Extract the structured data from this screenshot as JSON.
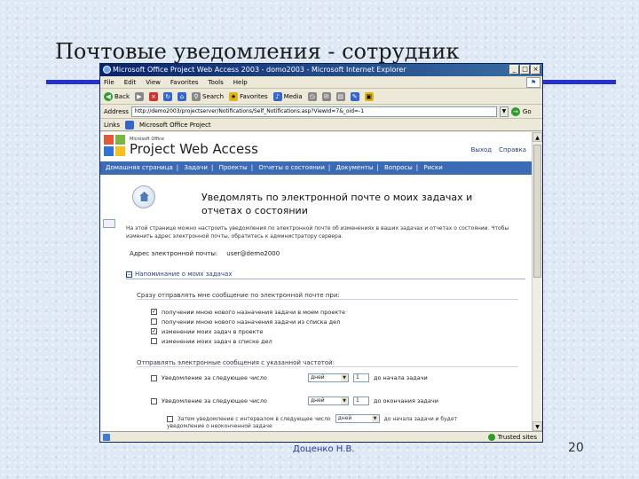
{
  "slide": {
    "title": "Почтовые уведомления - сотрудник",
    "author": "Доценко Н.В.",
    "page_number": "20",
    "accent_color": "#2233cc"
  },
  "window": {
    "title": "Microsoft Office Project Web Access 2003 - domo2003 - Microsoft Internet Explorer",
    "buttons": [
      "_",
      "□",
      "×"
    ],
    "menu": [
      "File",
      "Edit",
      "View",
      "Favorites",
      "Tools",
      "Help"
    ],
    "toolbar": {
      "back": "Back",
      "forward": "",
      "search": "Search",
      "favorites": "Favorites",
      "media": "Media"
    },
    "address_label": "Address",
    "address_value": "http://demo2003/projectserver/Notifications/Self_Notifications.asp?ViewId=7&_oid=-1",
    "go_label": "Go",
    "links_label": "Links",
    "links_item": "Microsoft Office Project",
    "status_zone": "Trusted sites"
  },
  "pwa": {
    "brand_small": "Microsoft Office",
    "brand": "Project Web Access",
    "header_links": [
      "Выход",
      "Справка"
    ],
    "nav": [
      "Домашняя страница",
      "Задачи",
      "Проекты",
      "Отчеты о состоянии",
      "Документы",
      "Вопросы",
      "Риски"
    ],
    "heading": "Уведомлять по электронной почте о моих задачах и отчетах о состоянии",
    "intro": "На этой странице можно настроить уведомления по электронной почте об изменениях в ваших задачах и отчетах о состоянии. Чтобы изменить адрес электронной почты, обратитесь к администратору сервера.",
    "email_label": "Адрес электронной почты:",
    "email_value": "user@demo2000",
    "section_title": "Напоминание о моих задачах",
    "section_toggle": "−",
    "immediate_head": "Сразу отправлять мне сообщение по электронной почте при:",
    "checkboxes": [
      {
        "label": "получении мною нового назначения задачи в моем проекте",
        "checked": true
      },
      {
        "label": "получении мною нового назначения задачи из списка дел",
        "checked": false
      },
      {
        "label": "изменении моих задач в проекте",
        "checked": true
      },
      {
        "label": "изменении моих задач в списке дел",
        "checked": false
      }
    ],
    "freq_head": "Отправлять электронные сообщения с указанной частотой:",
    "freq_rows": [
      {
        "label": "Уведомление за следующее число",
        "select": "дней",
        "num": "1",
        "suffix": "до начала задачи"
      },
      {
        "label": "Уведомление за следующее число",
        "select": "дней",
        "num": "1",
        "suffix": "до окончания задачи"
      }
    ],
    "last_row_label": "Затем уведомление с интервалом в следующее число",
    "last_row_select": "дней",
    "last_row_suffix": "до начала задачи и будет",
    "last_row_more": "уведомление о неоконченной задаче"
  }
}
